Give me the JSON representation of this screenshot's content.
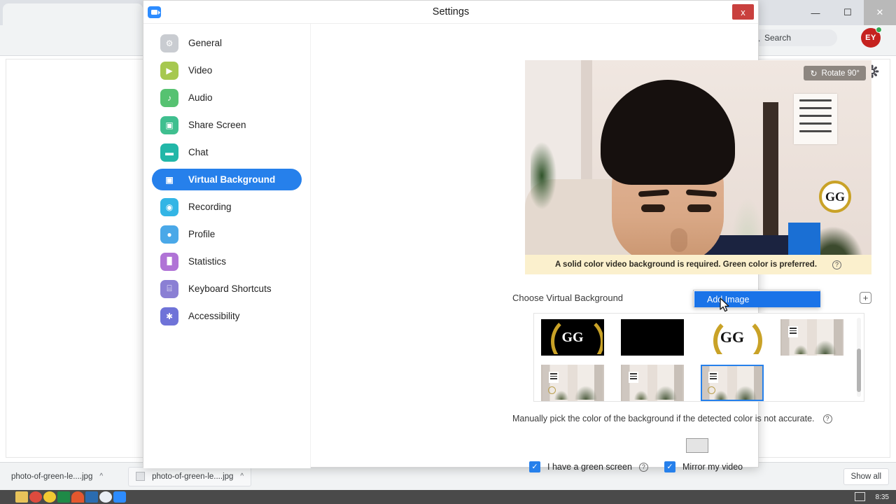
{
  "browser": {
    "window_controls": {
      "minimize": "—",
      "maximize": "☐",
      "close": "✕"
    },
    "search_placeholder": "Search",
    "search_icon": "search-icon",
    "avatar_initials": "EY",
    "gear_icon": "gear-icon"
  },
  "downloads": {
    "items": [
      {
        "name": "photo-of-green-le....jpg",
        "caret": "^"
      },
      {
        "name": "photo-of-green-le....jpg",
        "caret": "^"
      }
    ],
    "show_all_label": "Show all"
  },
  "taskbar": {
    "clock": "8:35",
    "icons": [
      {
        "name": "file-explorer-icon",
        "color": "#e8c35a"
      },
      {
        "name": "chrome-icon",
        "color": "#dd4b3e"
      },
      {
        "name": "folder-yellow-icon",
        "color": "#f2c832"
      },
      {
        "name": "excel-icon",
        "color": "#1f8a47"
      },
      {
        "name": "powerpoint-icon",
        "color": "#e4572e"
      },
      {
        "name": "word-icon",
        "color": "#2b6cb0"
      },
      {
        "name": "media-player-icon",
        "color": "#e9eef5"
      },
      {
        "name": "zoom-icon",
        "color": "#2d8cff"
      }
    ]
  },
  "dialog": {
    "title": "Settings",
    "app_icon": "zoom-camera-icon",
    "close_label": "x",
    "sidebar": {
      "items": [
        {
          "label": "General",
          "icon": "gear-icon",
          "color": "#c9ccd1",
          "glyph": "⚙",
          "active": false
        },
        {
          "label": "Video",
          "icon": "video-camera-icon",
          "color": "#a6c84f",
          "glyph": "▶",
          "active": false
        },
        {
          "label": "Audio",
          "icon": "headphones-icon",
          "color": "#56c271",
          "glyph": "♫",
          "active": false
        },
        {
          "label": "Share Screen",
          "icon": "share-screen-icon",
          "color": "#3fbf8f",
          "glyph": "▣",
          "active": false
        },
        {
          "label": "Chat",
          "icon": "chat-bubble-icon",
          "color": "#22b7a8",
          "glyph": "▬",
          "active": false
        },
        {
          "label": "Virtual Background",
          "icon": "person-frame-icon",
          "color": "#2680eb",
          "glyph": "▣",
          "active": true
        },
        {
          "label": "Recording",
          "icon": "record-circle-icon",
          "color": "#33b5e5",
          "glyph": "◉",
          "active": false
        },
        {
          "label": "Profile",
          "icon": "person-icon",
          "color": "#4aa8e8",
          "glyph": "●",
          "active": false
        },
        {
          "label": "Statistics",
          "icon": "bar-chart-icon",
          "color": "#b073d6",
          "glyph": "█",
          "active": false
        },
        {
          "label": "Keyboard Shortcuts",
          "icon": "keyboard-icon",
          "color": "#8a7fd4",
          "glyph": "⌸",
          "active": false
        },
        {
          "label": "Accessibility",
          "icon": "accessibility-icon",
          "color": "#6f73d8",
          "glyph": "✱",
          "active": false
        }
      ]
    },
    "video": {
      "rotate_label": "Rotate 90°",
      "rotate_icon": "rotate-icon",
      "wall_logo_text": "GG",
      "banner_text": "A solid color video background is required. Green color is preferred.",
      "banner_help_icon": "question-mark-icon"
    },
    "choose": {
      "label": "Choose Virtual Background",
      "add_icon": "plus-icon"
    },
    "thumbnails": [
      {
        "name": "gg-logo-dark",
        "kind": "logo-dark",
        "text": "GG",
        "selected": false
      },
      {
        "name": "black-background",
        "kind": "black",
        "text": "",
        "selected": false
      },
      {
        "name": "gg-logo-white",
        "kind": "logo-white",
        "text": "GG",
        "selected": false
      },
      {
        "name": "room-photo-1",
        "kind": "room",
        "text": "",
        "selected": false
      },
      {
        "name": "room-photo-2",
        "kind": "room",
        "text": "",
        "selected": false
      },
      {
        "name": "room-photo-3",
        "kind": "room",
        "text": "",
        "selected": false
      },
      {
        "name": "room-photo-4",
        "kind": "room",
        "text": "",
        "selected": true
      }
    ],
    "manual": {
      "label": "Manually pick the color of the background if the detected color is not accurate.",
      "help_icon": "question-mark-icon",
      "swatch_color": "#e4e4e4"
    },
    "checkboxes": [
      {
        "label": "I have a green screen",
        "checked": true,
        "help_icon": "question-mark-icon",
        "check_glyph": "✓"
      },
      {
        "label": "Mirror my video",
        "checked": true,
        "help_icon": "",
        "check_glyph": "✓"
      }
    ]
  },
  "context_menu": {
    "items": [
      {
        "label": "Add Image",
        "highlighted": true
      }
    ],
    "cursor_icon": "mouse-pointer-icon"
  },
  "colors": {
    "accent_blue": "#2680eb",
    "menu_blue": "#1a73e8",
    "banner_yellow": "#fbf0cd",
    "close_red": "#c9403e"
  }
}
